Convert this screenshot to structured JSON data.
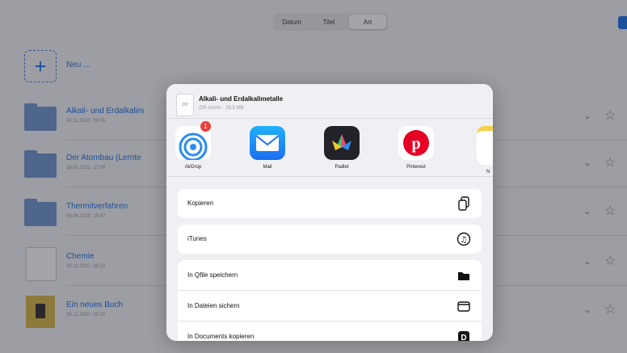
{
  "toolbar": {
    "segments": [
      "Datum",
      "Titel",
      "Art"
    ],
    "selected": "Art",
    "new_label": "Neu ..."
  },
  "files": [
    {
      "title": "Alkali- und Erdalkalim",
      "subtitle": "30.11.2020, 09:05",
      "type": "folder"
    },
    {
      "title": "Der Atombau (Lernte",
      "subtitle": "18.01.2021, 17:08",
      "type": "folder"
    },
    {
      "title": "Thermitverfahren",
      "subtitle": "09.06.2020, 15:47",
      "type": "folder"
    },
    {
      "title": "Chemie",
      "subtitle": "30.11.2020, 08:13",
      "type": "document"
    },
    {
      "title": "Ein neues Buch",
      "subtitle": "30.11.2020, 08:13",
      "type": "book"
    }
  ],
  "share": {
    "file_icon_text": "ZIP",
    "title": "Alkali- und Erdalkalimetalle",
    "subtitle": "ZIP-Archiv · 28,5 MB",
    "apps": [
      {
        "label": "AirDrop",
        "icon": "airdrop-icon",
        "badge": "1"
      },
      {
        "label": "Mail",
        "icon": "mail-icon"
      },
      {
        "label": "Padlet",
        "icon": "padlet-icon"
      },
      {
        "label": "Pinterest",
        "icon": "pinterest-icon"
      },
      {
        "label": "N",
        "icon": "notes-icon"
      }
    ],
    "actions": [
      {
        "label": "Kopieren",
        "icon": "copy-icon"
      },
      {
        "label": "iTunes",
        "icon": "music-icon"
      },
      {
        "label": "In Qfile speichern",
        "icon": "folder-icon"
      },
      {
        "label": "In Dateien sichern",
        "icon": "files-icon"
      },
      {
        "label": "In Documents kopieren",
        "icon": "documents-icon"
      }
    ]
  },
  "colors": {
    "accent": "#1e74e8",
    "badge": "#e8403a"
  }
}
